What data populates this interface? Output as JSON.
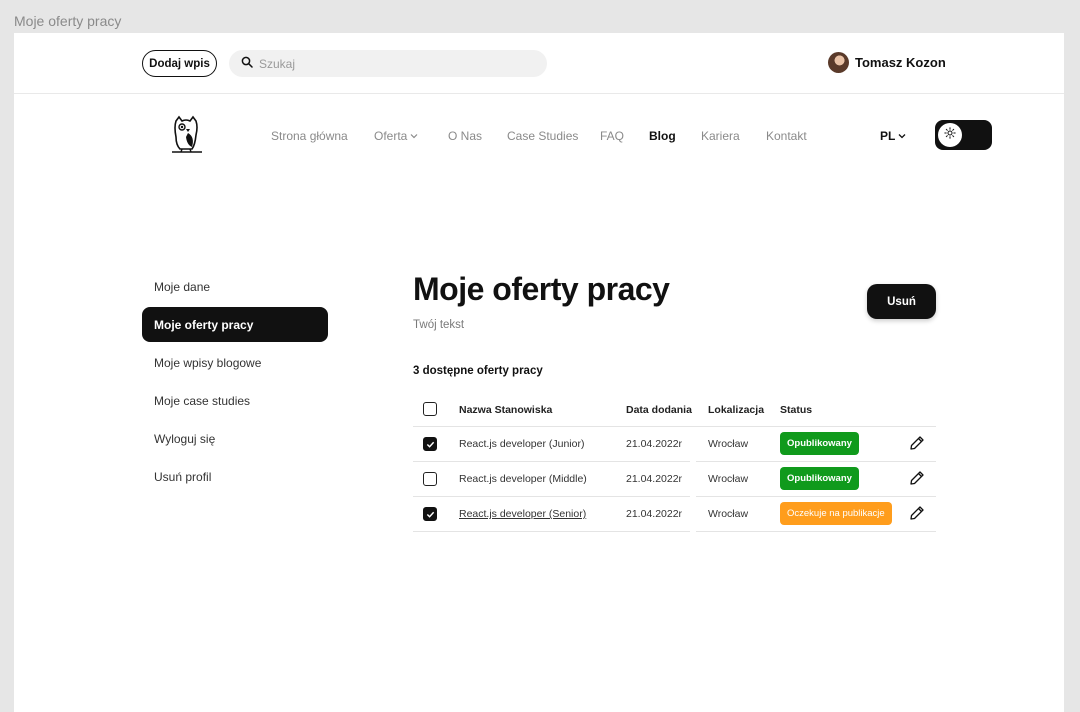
{
  "window": {
    "title": "Moje oferty pracy"
  },
  "topbar": {
    "add_label": "Dodaj wpis",
    "search_placeholder": "Szukaj",
    "user_name": "Tomasz Kozon"
  },
  "nav": {
    "items": [
      "Strona główna",
      "Oferta",
      "O Nas",
      "Case Studies",
      "FAQ",
      "Blog",
      "Kariera",
      "Kontakt"
    ],
    "active": "Blog",
    "lang": "PL"
  },
  "sidebar": {
    "items": [
      "Moje dane",
      "Moje oferty pracy",
      "Moje wpisy blogowe",
      "Moje case studies",
      "Wyloguj się",
      "Usuń profil"
    ],
    "active": "Moje oferty pracy"
  },
  "main": {
    "title": "Moje oferty pracy",
    "subtitle": "Twój tekst",
    "delete_label": "Usuń",
    "count_text": "3 dostępne oferty pracy"
  },
  "table": {
    "headers": [
      "Nazwa Stanowiska",
      "Data dodania",
      "Lokalizacja",
      "Status"
    ],
    "rows": [
      {
        "checked": true,
        "name": "React.js developer (Junior)",
        "date": "21.04.2022r",
        "location": "Wrocław",
        "status": "Opublikowany",
        "status_color": "#109a1c"
      },
      {
        "checked": false,
        "name": "React.js developer (Middle)",
        "date": "21.04.2022r",
        "location": "Wrocław",
        "status": "Opublikowany",
        "status_color": "#109a1c"
      },
      {
        "checked": true,
        "name": "React.js developer (Senior)",
        "date": "21.04.2022r",
        "location": "Wrocław",
        "status": "Oczekuje na publikacje",
        "status_color": "#ff9d1c"
      }
    ]
  },
  "icons": {
    "search": "search-icon",
    "chevron": "chevron-down-icon",
    "sun": "sun-icon",
    "edit": "pencil-icon",
    "logo": "owl-logo"
  }
}
